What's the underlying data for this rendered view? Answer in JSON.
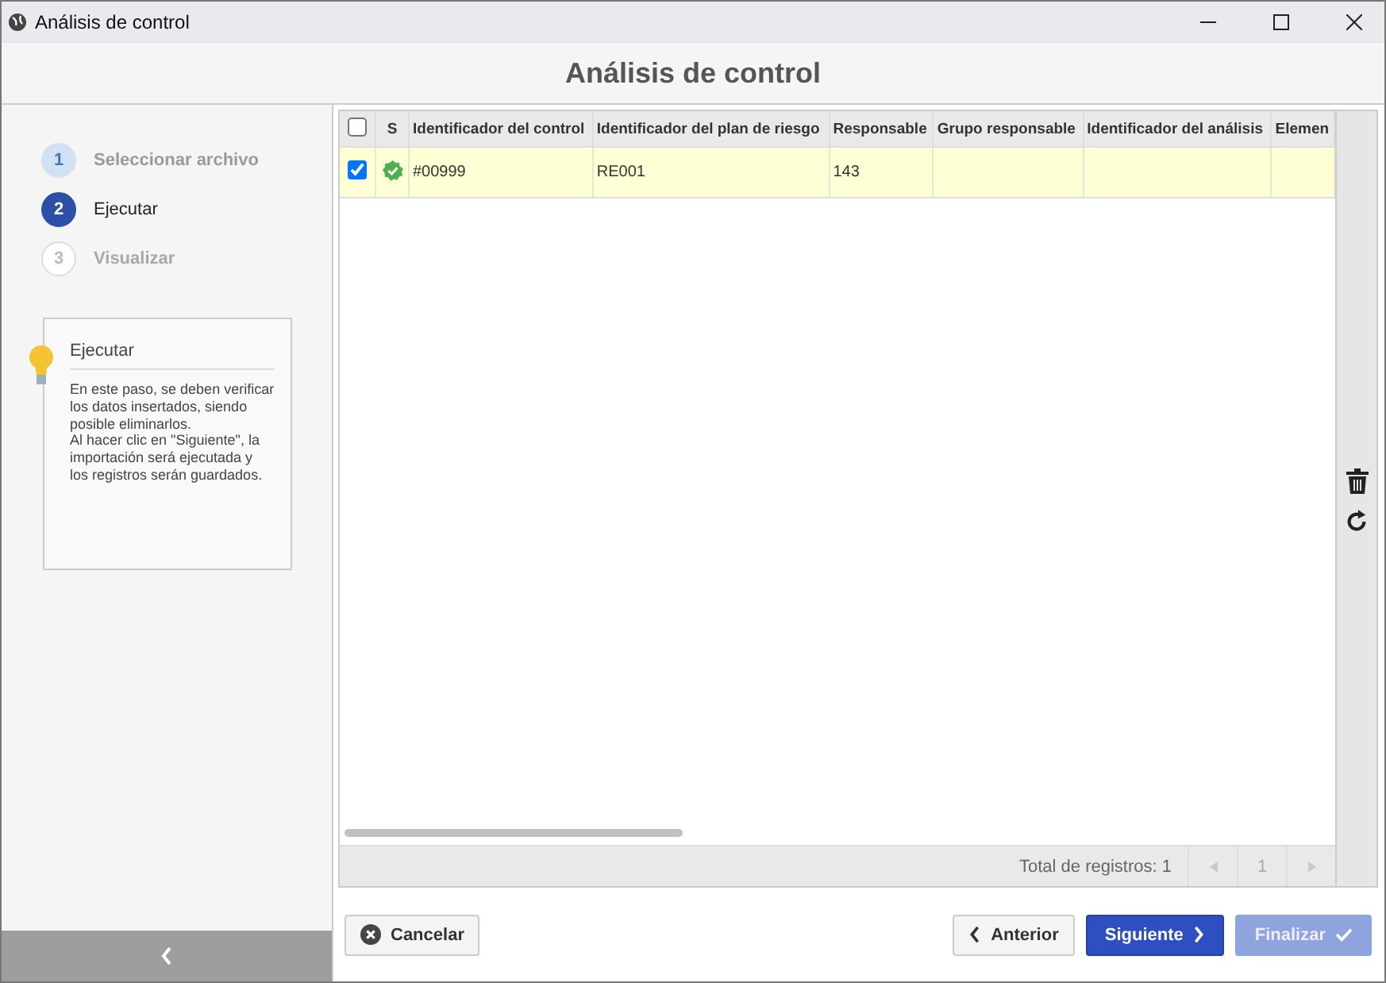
{
  "window": {
    "title": "Análisis de control"
  },
  "header": {
    "title": "Análisis de control"
  },
  "steps": [
    {
      "number": "1",
      "label": "Seleccionar archivo",
      "kind": "done"
    },
    {
      "number": "2",
      "label": "Ejecutar",
      "kind": "current"
    },
    {
      "number": "3",
      "label": "Visualizar",
      "kind": "pending"
    }
  ],
  "help": {
    "title": "Ejecutar",
    "text": "En este paso, se deben verificar los datos insertados, siendo posible eliminarlos.\nAl hacer clic en \"Siguiente\", la importación será ejecutada y los registros serán guardados."
  },
  "table": {
    "select_all": {
      "checked": false
    },
    "status_header": "S",
    "columns": [
      "Identificador del control",
      "Identificador del plan de riesgo",
      "Responsable",
      "Grupo responsable",
      "Identificador del análisis",
      "Elemen"
    ],
    "rows": [
      {
        "selected": true,
        "checked": true,
        "kind": "ok",
        "cells": [
          "#00999",
          "RE001",
          "143"
        ]
      }
    ]
  },
  "pagination": {
    "total": "Total de registros: 1",
    "page": "1",
    "prev_disabled": true,
    "next_disabled": true
  },
  "buttons": [
    {
      "label": "Cancelar",
      "kind": "cancel",
      "disabled": false
    },
    {
      "label": "Anterior",
      "kind": "back",
      "disabled": false
    },
    {
      "label": "Siguiente",
      "kind": "next",
      "disabled": false
    },
    {
      "label": "Finalizar",
      "kind": "finish",
      "disabled": true
    }
  ]
}
